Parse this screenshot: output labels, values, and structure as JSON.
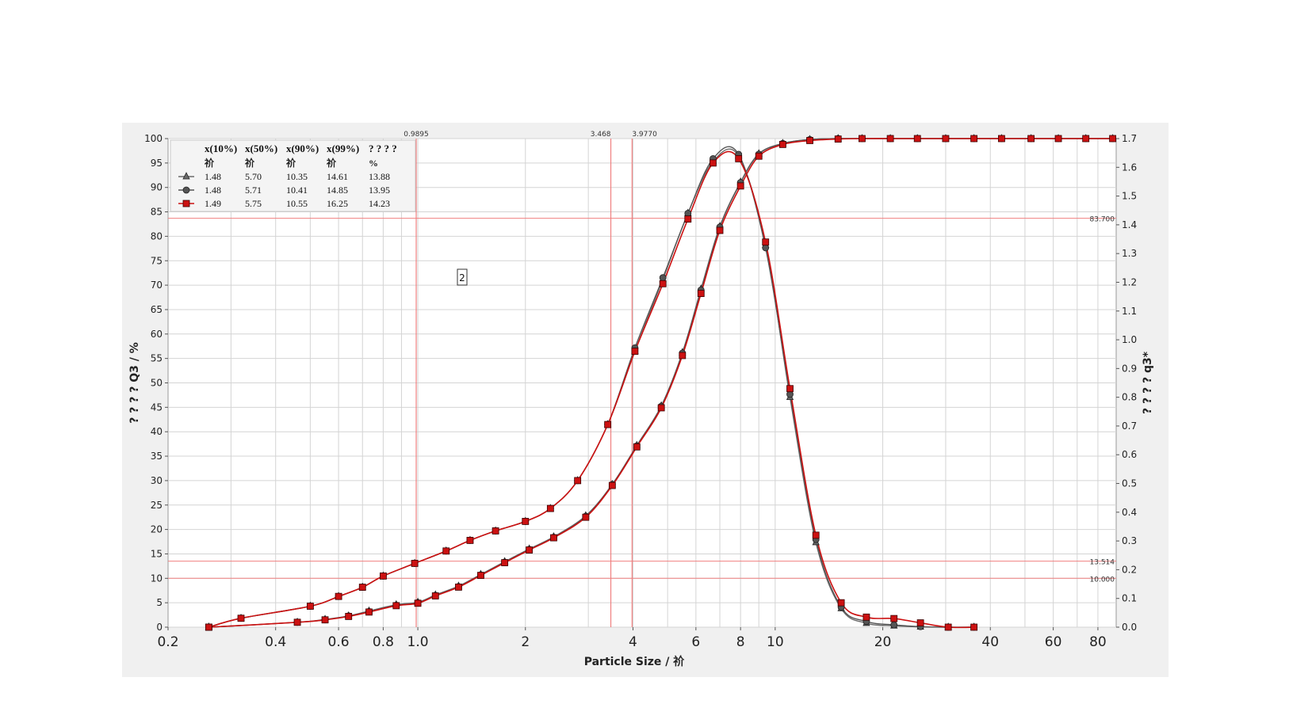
{
  "chart_data": {
    "type": "line",
    "x_scale": "log",
    "xlabel": "Particle Size / 祄",
    "ylabel_left": "? ? ? ? Q3 / %",
    "ylabel_right": "? ? ? ? q3*",
    "xlim": [
      0.2,
      90
    ],
    "ylim_left": [
      0,
      100
    ],
    "ylim_right": [
      0,
      1.7
    ],
    "x_ticks": [
      0.2,
      0.4,
      0.6,
      0.8,
      1.0,
      2,
      4,
      6,
      8,
      10,
      20,
      40,
      60,
      80
    ],
    "x_tick_labels": [
      "0.2",
      "0.4",
      "0.6",
      "0.8",
      "1.0",
      "2",
      "4",
      "6",
      "8",
      "10",
      "20",
      "40",
      "60",
      "80"
    ],
    "y_left_ticks": [
      0,
      5,
      10,
      15,
      20,
      25,
      30,
      35,
      40,
      45,
      50,
      55,
      60,
      65,
      70,
      75,
      80,
      85,
      90,
      95,
      100
    ],
    "y_right_ticks": [
      "0.0",
      "0.1",
      "0.2",
      "0.3",
      "0.4",
      "0.5",
      "0.6",
      "0.7",
      "0.8",
      "0.9",
      "1.0",
      "1.1",
      "1.2",
      "1.3",
      "1.4",
      "1.5",
      "1.6",
      "1.7"
    ],
    "grid": true,
    "legend_table": {
      "headers": [
        "x(10%)",
        "x(50%)",
        "x(90%)",
        "x(99%)",
        "? ? ? ?"
      ],
      "units": [
        "祄",
        "祄",
        "祄",
        "祄",
        "%"
      ],
      "rows": [
        {
          "marker": "triangle",
          "color": "#6b6b6b",
          "values": [
            "1.48",
            "5.70",
            "10.35",
            "14.61",
            "13.88"
          ]
        },
        {
          "marker": "circle",
          "color": "#555555",
          "values": [
            "1.48",
            "5.71",
            "10.41",
            "14.85",
            "13.95"
          ]
        },
        {
          "marker": "square",
          "color": "#cc1111",
          "values": [
            "1.49",
            "5.75",
            "10.55",
            "16.25",
            "14.23"
          ]
        }
      ]
    },
    "reference_lines": {
      "vertical": [
        {
          "x": 0.9895,
          "label": "0.9895"
        },
        {
          "x": 3.468,
          "label": "3.468"
        },
        {
          "x": 3.977,
          "label": "3.9770"
        }
      ],
      "horizontal": [
        {
          "y": 83.7,
          "label": "83.700"
        },
        {
          "y": 13.514,
          "label": "13.514"
        },
        {
          "y": 10.0,
          "label": "10.000"
        }
      ]
    },
    "annotation": "2",
    "series": [
      {
        "name": "",
        "axis": "left",
        "kind": "cumulative Q3",
        "color": "#6b6b6b",
        "marker": "triangle",
        "x": [
          0.26,
          0.46,
          0.55,
          0.64,
          0.73,
          0.87,
          1.0,
          1.12,
          1.3,
          1.5,
          1.75,
          2.05,
          2.4,
          2.95,
          3.5,
          4.1,
          4.8,
          5.5,
          6.2,
          7.0,
          8.0,
          9.0,
          10.5,
          12.5,
          15.0,
          17.5,
          21.0,
          25.0,
          30.0,
          36.0,
          43.0,
          52.0,
          62.0,
          74.0,
          88.0
        ],
        "y": [
          0,
          1.0,
          1.6,
          2.3,
          3.3,
          4.6,
          5.1,
          6.6,
          8.4,
          10.8,
          13.4,
          16.0,
          18.5,
          22.8,
          29.2,
          37.2,
          45.3,
          56.2,
          69.2,
          82.0,
          91.1,
          96.9,
          99.0,
          99.8,
          100,
          100,
          100,
          100,
          100,
          100,
          100,
          100,
          100,
          100,
          100
        ]
      },
      {
        "name": "",
        "axis": "left",
        "kind": "cumulative Q3",
        "color": "#555555",
        "marker": "circle",
        "x": [
          0.26,
          0.46,
          0.55,
          0.64,
          0.73,
          0.87,
          1.0,
          1.12,
          1.3,
          1.5,
          1.75,
          2.05,
          2.4,
          2.95,
          3.5,
          4.1,
          4.8,
          5.5,
          6.2,
          7.0,
          8.0,
          9.0,
          10.5,
          12.5,
          15.0,
          17.5,
          21.0,
          25.0,
          30.0,
          36.0,
          43.0,
          52.0,
          62.0,
          74.0,
          88.0
        ],
        "y": [
          0,
          1.0,
          1.5,
          2.3,
          3.2,
          4.5,
          5.0,
          6.5,
          8.3,
          10.7,
          13.3,
          15.9,
          18.4,
          22.7,
          29.2,
          37.1,
          45.2,
          56.1,
          69.0,
          81.9,
          91.0,
          96.8,
          99.0,
          99.8,
          100,
          100,
          100,
          100,
          100,
          100,
          100,
          100,
          100,
          100,
          100
        ]
      },
      {
        "name": "",
        "axis": "left",
        "kind": "cumulative Q3",
        "color": "#cc1111",
        "marker": "square",
        "x": [
          0.26,
          0.46,
          0.55,
          0.64,
          0.73,
          0.87,
          1.0,
          1.12,
          1.3,
          1.5,
          1.75,
          2.05,
          2.4,
          2.95,
          3.5,
          4.1,
          4.8,
          5.5,
          6.2,
          7.0,
          8.0,
          9.0,
          10.5,
          12.5,
          15.0,
          17.5,
          21.0,
          25.0,
          30.0,
          36.0,
          43.0,
          52.0,
          62.0,
          74.0,
          88.0
        ],
        "y": [
          0,
          1.0,
          1.5,
          2.2,
          3.1,
          4.4,
          4.9,
          6.4,
          8.2,
          10.6,
          13.2,
          15.8,
          18.3,
          22.5,
          29.0,
          36.9,
          44.9,
          55.6,
          68.3,
          81.2,
          90.3,
          96.4,
          98.8,
          99.6,
          99.9,
          100,
          100,
          100,
          100,
          100,
          100,
          100,
          100,
          100,
          100
        ]
      },
      {
        "name": "",
        "axis": "right",
        "kind": "density q3*",
        "color": "#6b6b6b",
        "marker": "triangle",
        "x": [
          0.26,
          0.32,
          0.5,
          0.6,
          0.7,
          0.8,
          0.98,
          1.2,
          1.4,
          1.65,
          2.0,
          2.35,
          2.8,
          3.4,
          4.05,
          4.85,
          5.7,
          6.7,
          7.9,
          9.4,
          11.0,
          13.0,
          15.3,
          18.0,
          21.5,
          25.5,
          30.5,
          36.0
        ],
        "y": [
          0,
          0.031,
          0.073,
          0.107,
          0.139,
          0.178,
          0.222,
          0.265,
          0.302,
          0.335,
          0.368,
          0.413,
          0.51,
          0.705,
          0.96,
          1.21,
          1.44,
          1.62,
          1.64,
          1.33,
          0.8,
          0.295,
          0.065,
          0.014,
          0.005,
          0.001,
          0,
          0
        ]
      },
      {
        "name": "",
        "axis": "right",
        "kind": "density q3*",
        "color": "#555555",
        "marker": "circle",
        "x": [
          0.26,
          0.32,
          0.5,
          0.6,
          0.7,
          0.8,
          0.98,
          1.2,
          1.4,
          1.65,
          2.0,
          2.35,
          2.8,
          3.4,
          4.05,
          4.85,
          5.7,
          6.7,
          7.9,
          9.4,
          11.0,
          13.0,
          15.3,
          18.0,
          21.5,
          25.5,
          30.5,
          36.0
        ],
        "y": [
          0,
          0.031,
          0.073,
          0.107,
          0.139,
          0.178,
          0.222,
          0.265,
          0.302,
          0.335,
          0.368,
          0.413,
          0.51,
          0.706,
          0.972,
          1.216,
          1.44,
          1.63,
          1.645,
          1.32,
          0.81,
          0.305,
          0.07,
          0.02,
          0.008,
          0.002,
          0,
          0
        ]
      },
      {
        "name": "",
        "axis": "right",
        "kind": "density q3*",
        "color": "#cc1111",
        "marker": "square",
        "x": [
          0.26,
          0.32,
          0.5,
          0.6,
          0.7,
          0.8,
          0.98,
          1.2,
          1.4,
          1.65,
          2.0,
          2.35,
          2.8,
          3.4,
          4.05,
          4.85,
          5.7,
          6.7,
          7.9,
          9.4,
          11.0,
          13.0,
          15.3,
          18.0,
          21.5,
          25.5,
          30.5,
          36.0
        ],
        "y": [
          0,
          0.031,
          0.073,
          0.107,
          0.139,
          0.178,
          0.222,
          0.265,
          0.302,
          0.335,
          0.368,
          0.413,
          0.51,
          0.705,
          0.96,
          1.195,
          1.42,
          1.615,
          1.63,
          1.34,
          0.83,
          0.32,
          0.085,
          0.035,
          0.03,
          0.015,
          0,
          0
        ]
      }
    ]
  }
}
